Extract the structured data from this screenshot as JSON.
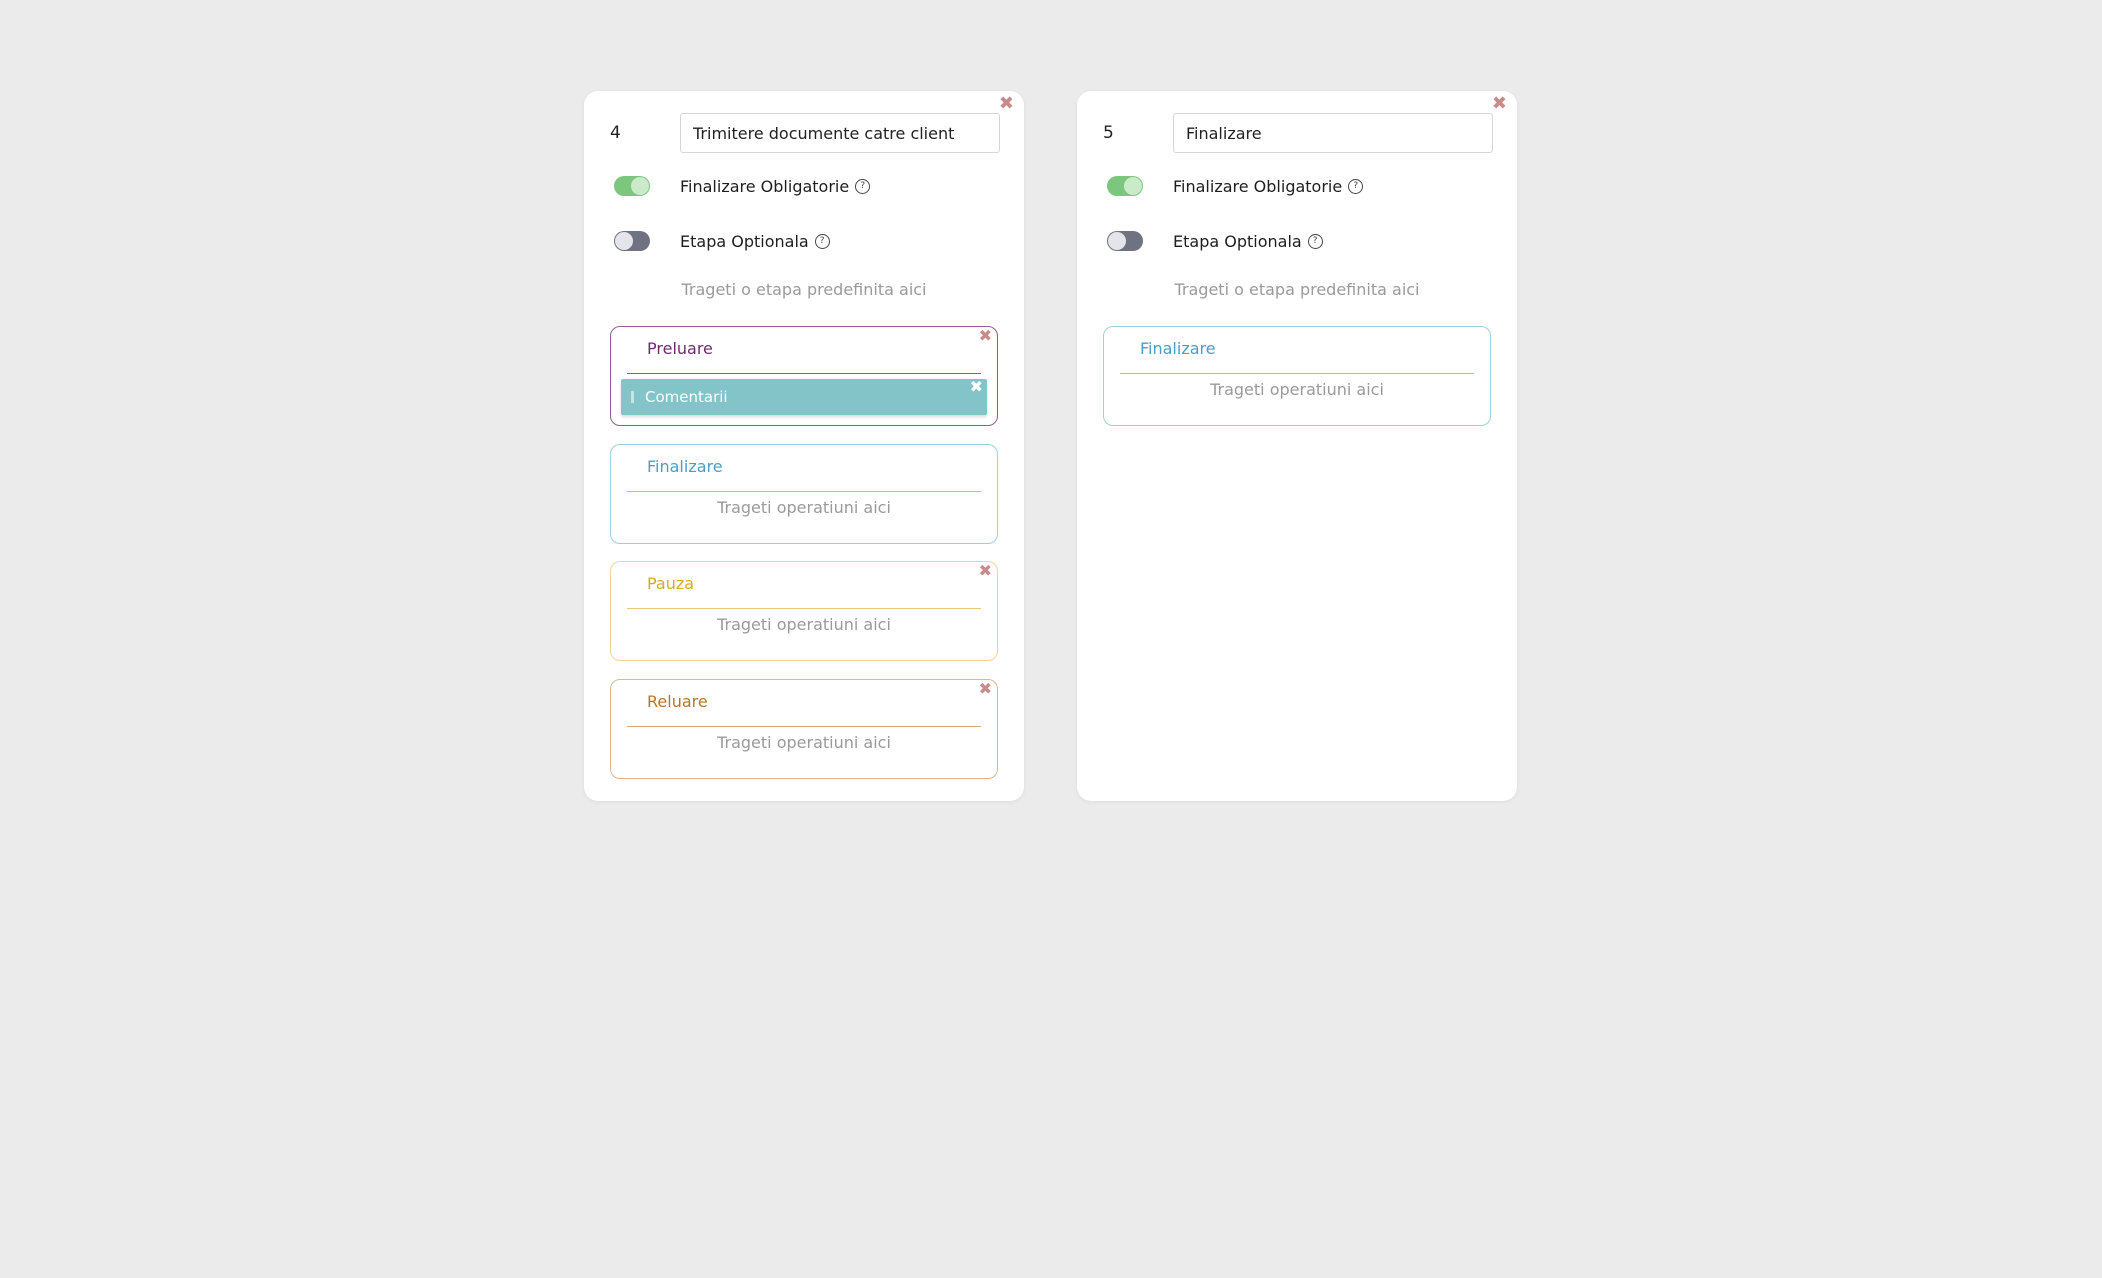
{
  "cards": [
    {
      "number": "4",
      "name": "Trimitere documente catre client",
      "close": "✖",
      "toggle_mandatory": {
        "label": "Finalizare Obligatorie",
        "on": true
      },
      "toggle_optional": {
        "label": "Etapa Optionala",
        "on": false
      },
      "help_glyph": "?",
      "drop_hint": "Trageti o etapa predefinita aici",
      "operations": [
        {
          "title": "Preluare",
          "close": "✖",
          "items": [
            {
              "label": "Comentarii",
              "close": "✖"
            }
          ]
        },
        {
          "title": "Finalizare",
          "hint": "Trageti operatiuni aici"
        },
        {
          "title": "Pauza",
          "hint": "Trageti operatiuni aici",
          "close": "✖"
        },
        {
          "title": "Reluare",
          "hint": "Trageti operatiuni aici",
          "close": "✖"
        }
      ]
    },
    {
      "number": "5",
      "name": "Finalizare",
      "close": "✖",
      "toggle_mandatory": {
        "label": "Finalizare Obligatorie",
        "on": true
      },
      "toggle_optional": {
        "label": "Etapa Optionala",
        "on": false
      },
      "help_glyph": "?",
      "drop_hint": "Trageti o etapa predefinita aici",
      "operations": [
        {
          "title": "Finalizare",
          "hint": "Trageti operatiuni aici"
        }
      ]
    }
  ],
  "colors": {
    "background": "#ebebeb",
    "toggle_on": "#7dc67e",
    "toggle_off": "#6f7280",
    "close": "#c98a8a",
    "preluare": "#6b2e6b",
    "finalizare": "#4a9ec4",
    "pauza": "#d7aa24",
    "reluare": "#b5782b",
    "chip": "#82c4c8"
  }
}
